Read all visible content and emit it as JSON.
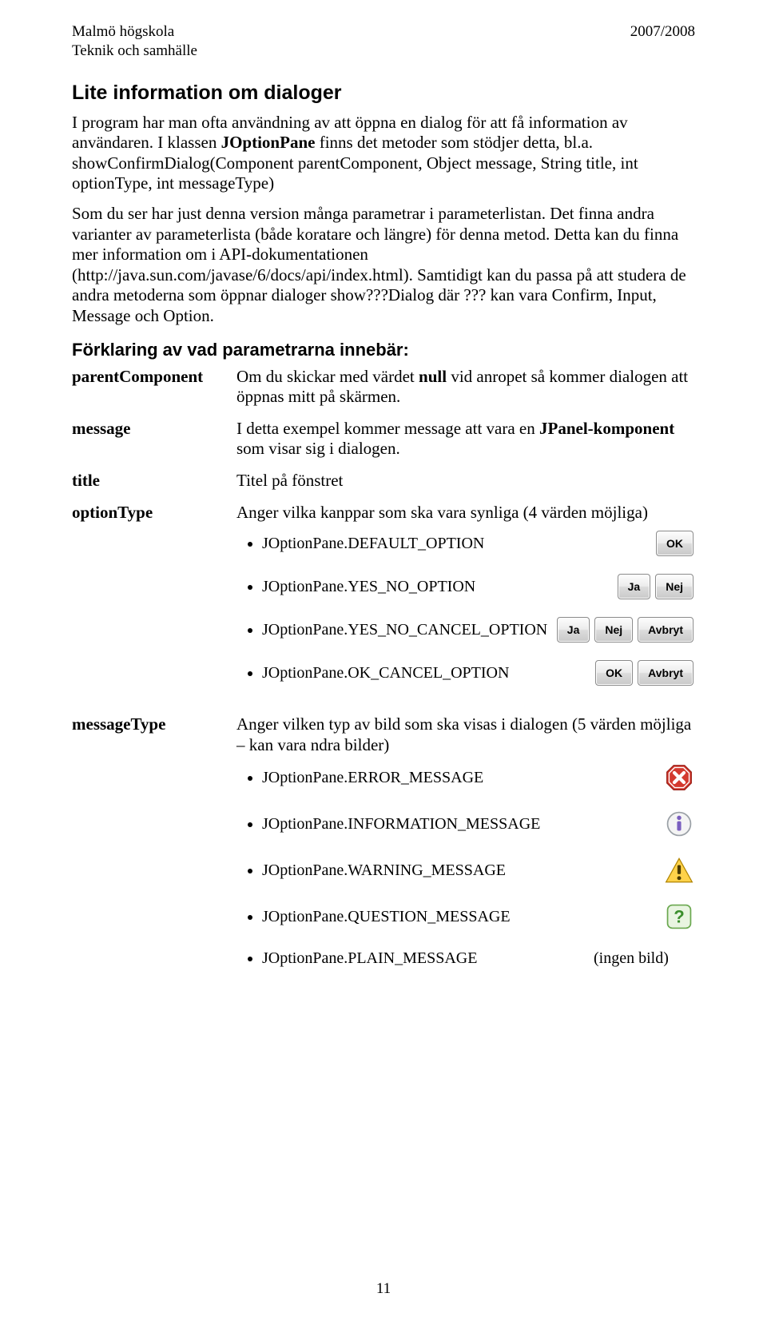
{
  "header": {
    "left1": "Malmö högskola",
    "left2": "Teknik och samhälle",
    "right": "2007/2008"
  },
  "h1": "Lite information om dialoger",
  "intro": "I program har man ofta användning av att öppna en dialog för att få information av användaren. I klassen JOptionPane finns det metoder som stödjer detta, bl.a. showConfirmDialog(Component parentComponent, Object message, String title, int optionType, int messageType)",
  "para2": "Som du ser har just denna version många parametrar i parameterlistan. Det finna andra varianter av parameterlista (både koratare och längre) för denna metod. Detta kan du finna mer information om i API-dokumentationen (http://java.sun.com/javase/6/docs/api/index.html). Samtidigt kan du passa på att studera de andra metoderna som öppnar dialoger show???Dialog där ??? kan vara Confirm, Input, Message och Option.",
  "h2": "Förklaring av vad parametrarna innebär:",
  "rows": {
    "parentComponent": {
      "label": "parentComponent",
      "text_a": "Om du skickar med värdet ",
      "text_b": "null",
      "text_c": " vid anropet så kommer dialogen att öppnas mitt på skärmen."
    },
    "message": {
      "label": "message",
      "text_a": "I detta exempel kommer message att vara en ",
      "text_b": "JPanel-komponent",
      "text_c": " som visar sig i dialogen."
    },
    "title": {
      "label": "title",
      "text": "Titel på fönstret"
    },
    "optionType": {
      "label": "optionType",
      "text": "Anger vilka kanppar som ska vara synliga (4 värden möjliga)"
    },
    "messageType": {
      "label": "messageType",
      "text": "Anger vilken typ av bild som ska visas i dialogen (5 värden möjliga – kan vara ndra bilder)"
    }
  },
  "optionType_opts": [
    {
      "k": "JOptionPane.DEFAULT_OPTION",
      "btns": [
        "OK"
      ]
    },
    {
      "k": "JOptionPane.YES_NO_OPTION",
      "btns": [
        "Ja",
        "Nej"
      ]
    },
    {
      "k": "JOptionPane.YES_NO_CANCEL_OPTION",
      "btns": [
        "Ja",
        "Nej",
        "Avbryt"
      ]
    },
    {
      "k": "JOptionPane.OK_CANCEL_OPTION",
      "btns": [
        "OK",
        "Avbryt"
      ]
    }
  ],
  "messageType_opts": [
    {
      "k": "JOptionPane.ERROR_MESSAGE",
      "icon": "error"
    },
    {
      "k": "JOptionPane.INFORMATION_MESSAGE",
      "icon": "info"
    },
    {
      "k": "JOptionPane.WARNING_MESSAGE",
      "icon": "warning"
    },
    {
      "k": "JOptionPane.QUESTION_MESSAGE",
      "icon": "question"
    },
    {
      "k": "JOptionPane.PLAIN_MESSAGE",
      "trail": "(ingen bild)"
    }
  ],
  "pagenum": "11",
  "labels": {
    "ok": "OK",
    "ja": "Ja",
    "nej": "Nej",
    "avbryt": "Avbryt"
  }
}
